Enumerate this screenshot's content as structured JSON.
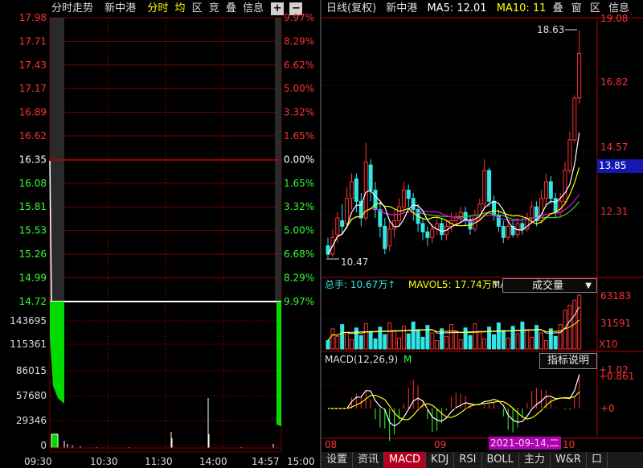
{
  "intraday": {
    "title": "分时走势",
    "stock_name": "新中港",
    "buttons": {
      "fenshi": "分时",
      "jun": "均",
      "qu": "区",
      "jing": "竞",
      "die": "叠",
      "info": "信息",
      "plus": "+",
      "minus": "−"
    },
    "price_labels": [
      "17.98",
      "17.71",
      "17.43",
      "17.17",
      "16.89",
      "16.62",
      "16.35",
      "16.08",
      "15.81",
      "15.53",
      "15.26",
      "14.99",
      "14.72"
    ],
    "pct_labels": [
      "9.97%",
      "8.29%",
      "6.62%",
      "5.00%",
      "3.32%",
      "1.65%",
      "0.00%",
      "1.65%",
      "3.32%",
      "5.00%",
      "6.68%",
      "8.29%",
      "9.97%"
    ],
    "vol_labels": [
      "143695",
      "115361",
      "86015",
      "57680",
      "29346",
      "0"
    ],
    "time_labels": [
      "09:30",
      "10:30",
      "11:30",
      "14:00",
      "14:57",
      "15:00"
    ],
    "colors": {
      "up": "#ff3232",
      "down": "#32ff32",
      "neutral": "#ffffff",
      "grid": "#7a0000"
    }
  },
  "daily": {
    "title": "日线(复权)",
    "stock_name": "新中港",
    "ma5_label": "MA5: 12.01",
    "ma10_label": "MA10: 11",
    "buttons": {
      "die": "叠",
      "chuang": "窗",
      "qu": "区",
      "info": "信息"
    },
    "price_labels": [
      "19.08",
      "16.82",
      "14.57",
      "12.31"
    ],
    "current_price": "13.85",
    "high_label": "18.63",
    "low_label": "10.47",
    "volume_header": "总手: 10.67万↑",
    "mavol5": "MAVOL5: 17.74万↑",
    "mavol_trunc": "MA",
    "volume_dropdown": "成交量",
    "vol_labels": [
      "63183",
      "31591",
      "X10"
    ],
    "macd_header": "MACD(12,26,9)",
    "macd_trunc": "M",
    "indicator_button": "指标说明",
    "macd_labels": [
      "+1.02",
      "+0.861",
      "+0"
    ],
    "x_labels": [
      "08",
      "09",
      "10"
    ],
    "date_tag": "2021-09-14,二",
    "colors": {
      "up": "#ff3232",
      "down": "#32e6e6",
      "ma5": "#ffffff",
      "ma10": "#ffff00",
      "ma20": "#e600e6",
      "ma30": "#32c832",
      "blue_tag": "#1418b0"
    }
  },
  "bottom_tabs": [
    "设置",
    "资讯",
    "MACD",
    "KDJ",
    "RSI",
    "BOLL",
    "主力",
    "W&R",
    "口"
  ],
  "active_tab": "MACD",
  "chart_data": {
    "type": "line",
    "title": "",
    "x": [
      "09:30",
      "10:30",
      "11:30",
      "14:00",
      "14:57",
      "15:00"
    ],
    "series": [
      {
        "values": [
          16.35,
          14.72,
          14.72,
          14.72,
          14.72,
          14.72
        ]
      }
    ],
    "ylim": [
      14.72,
      17.98
    ]
  }
}
